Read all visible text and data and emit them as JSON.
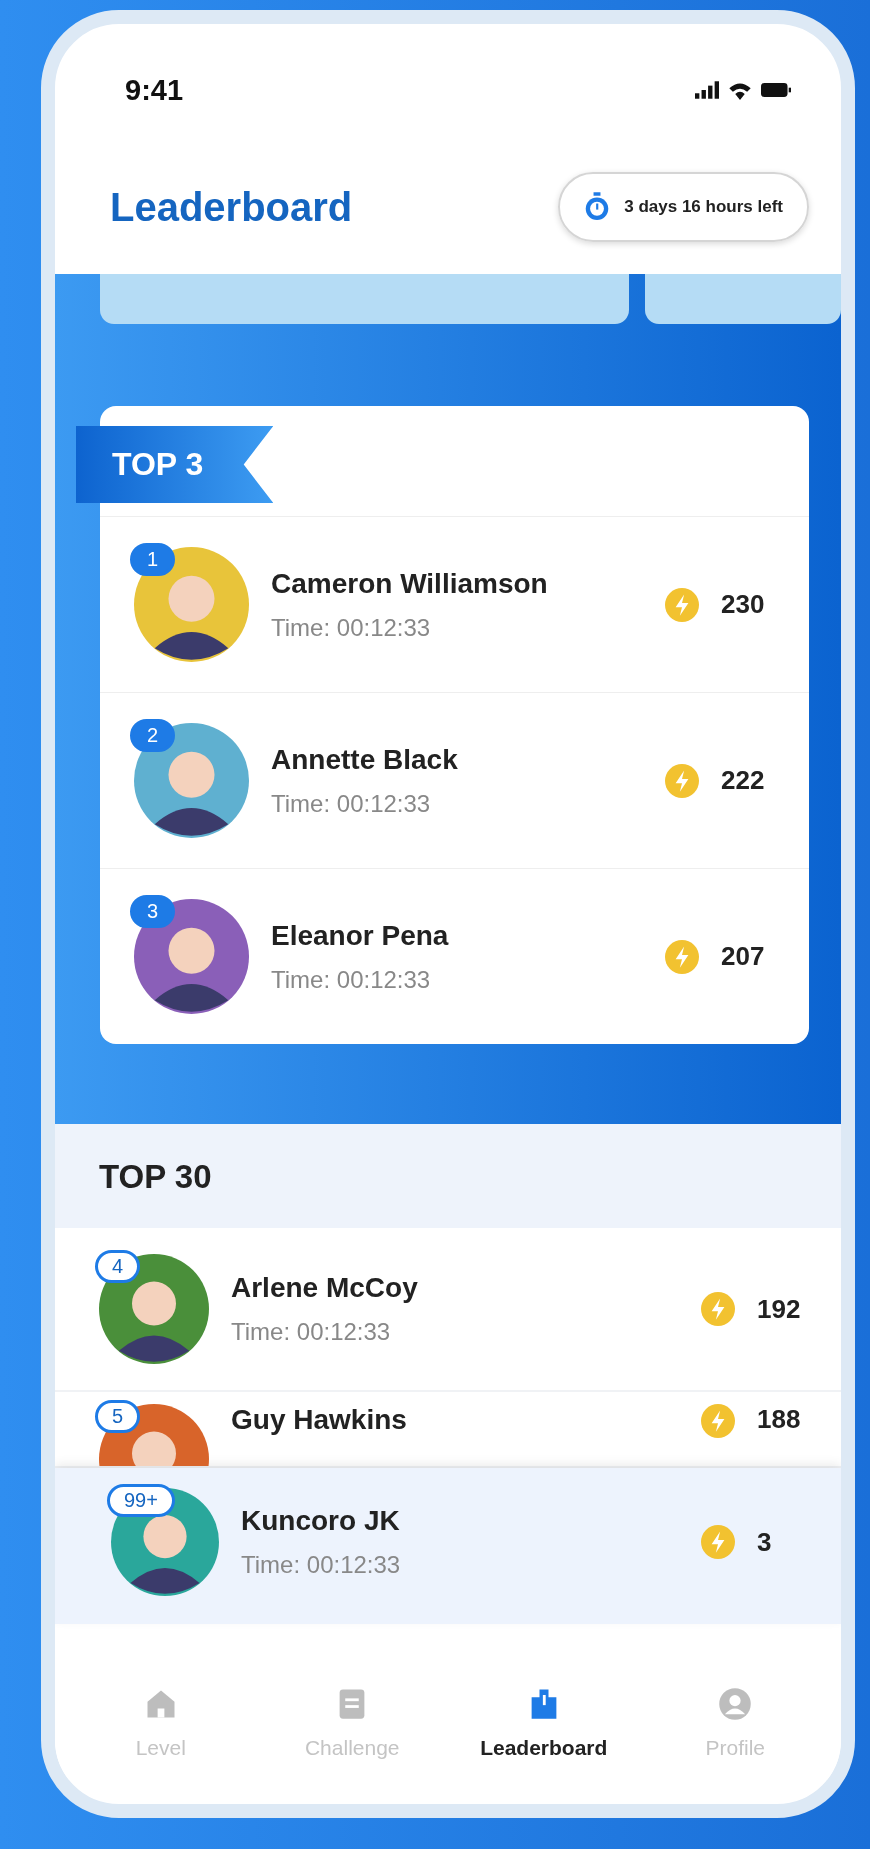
{
  "status_bar": {
    "time": "9:41"
  },
  "header": {
    "title": "Leaderboard",
    "timer": "3 days 16 hours left"
  },
  "top3": {
    "title": "TOP 3",
    "rows": [
      {
        "rank": "1",
        "name": "Cameron Williamson",
        "time": "Time: 00:12:33",
        "score": "230",
        "color": "#e8c43a"
      },
      {
        "rank": "2",
        "name": "Annette Black",
        "time": "Time: 00:12:33",
        "score": "222",
        "color": "#5fb0d0"
      },
      {
        "rank": "3",
        "name": "Eleanor Pena",
        "time": "Time: 00:12:33",
        "score": "207",
        "color": "#8a5fb8"
      }
    ]
  },
  "top30": {
    "title": "TOP 30",
    "rows": [
      {
        "rank": "4",
        "name": "Arlene McCoy",
        "time": "Time: 00:12:33",
        "score": "192",
        "color": "#4a8f3a"
      },
      {
        "rank": "5",
        "name": "Guy Hawkins",
        "score": "188",
        "color": "#d8642a"
      }
    ]
  },
  "my_rank": {
    "rank": "99+",
    "name": "Kuncoro JK",
    "time": "Time: 00:12:33",
    "score": "3",
    "color": "#2aa79b"
  },
  "nav": [
    {
      "label": "Level",
      "kind": "home",
      "selected": false
    },
    {
      "label": "Challenge",
      "kind": "document",
      "selected": false
    },
    {
      "label": "Leaderboard",
      "kind": "leaderboard",
      "selected": true
    },
    {
      "label": "Profile",
      "kind": "profile",
      "selected": false
    }
  ]
}
